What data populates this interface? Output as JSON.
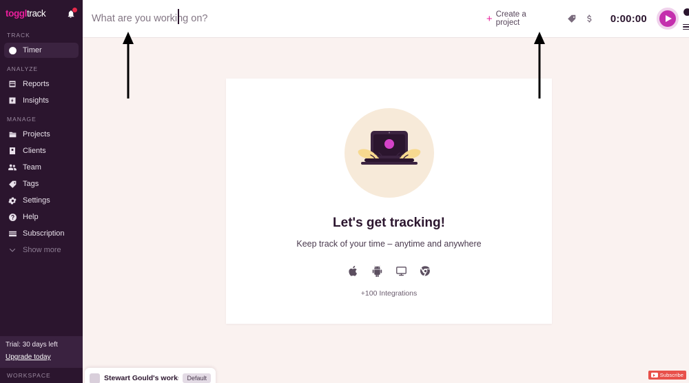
{
  "sidebar": {
    "brand": {
      "first": "toggl",
      "second": "track"
    },
    "bell_icon": "bell-icon",
    "sections": [
      {
        "label": "TRACK",
        "items": [
          {
            "label": "Timer",
            "icon": "clock-icon",
            "active": true
          }
        ]
      },
      {
        "label": "ANALYZE",
        "items": [
          {
            "label": "Reports",
            "icon": "reports-icon",
            "active": false
          },
          {
            "label": "Insights",
            "icon": "insights-icon",
            "active": false
          }
        ]
      },
      {
        "label": "MANAGE",
        "items": [
          {
            "label": "Projects",
            "icon": "folder-icon",
            "active": false
          },
          {
            "label": "Clients",
            "icon": "person-card-icon",
            "active": false
          },
          {
            "label": "Team",
            "icon": "people-icon",
            "active": false
          },
          {
            "label": "Tags",
            "icon": "tag-icon",
            "active": false
          },
          {
            "label": "Settings",
            "icon": "gear-icon",
            "active": false
          },
          {
            "label": "Help",
            "icon": "question-circle-icon",
            "active": false
          },
          {
            "label": "Subscription",
            "icon": "card-icon",
            "active": false
          },
          {
            "label": "Show more",
            "icon": "chevron-down-icon",
            "active": false,
            "muted": true
          }
        ]
      }
    ],
    "trial": {
      "status": "Trial: 30 days left",
      "upgrade_link": "Upgrade today"
    },
    "workspace_label": "WORKSPACE"
  },
  "header": {
    "task_placeholder": "What are you working on?",
    "task_value": "",
    "create_project_label": "Create a project",
    "plus": "+",
    "tag_icon": "tag-icon",
    "billable_icon": "dollar-icon",
    "timer_display": "0:00:00",
    "play_icon": "play-icon",
    "mode_icon": "timer-mode-clock-icon",
    "menu_icon": "hamburger-menu-icon"
  },
  "empty_state": {
    "illustration": "laptop-hands-illustration",
    "title": "Let's get tracking!",
    "subtitle": "Keep track of your time – anytime and anywhere",
    "platforms": [
      {
        "name": "apple-icon"
      },
      {
        "name": "android-icon"
      },
      {
        "name": "desktop-icon"
      },
      {
        "name": "chrome-icon"
      }
    ],
    "integrations_label": "+100 Integrations"
  },
  "workspace_popover": {
    "name": "Stewart Gould's workspace",
    "badge": "Default"
  },
  "youtube_overlay": {
    "label": "Subscribe"
  },
  "annotations": [
    {
      "name": "arrow-to-task-input"
    },
    {
      "name": "arrow-to-create-project"
    }
  ],
  "colors": {
    "sidebar_bg": "#2b152e",
    "accent_pink": "#e91e9b",
    "play_button": "#c42fad",
    "page_bg": "#faf2f0",
    "card_bg": "#ffffff",
    "illustration_circle": "#f7ead9",
    "notification_red": "#e8294a",
    "youtube_red": "#e8504a"
  }
}
